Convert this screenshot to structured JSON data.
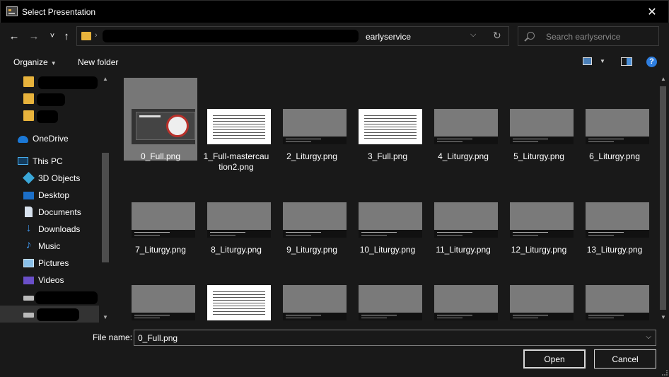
{
  "window": {
    "title": "Select Presentation",
    "close_glyph": "✕"
  },
  "nav": {
    "back_glyph": "←",
    "forward_glyph": "→",
    "recent_glyph": "˅",
    "up_glyph": "↑",
    "address_current": "earlyservice",
    "search_placeholder": "Search earlyservice"
  },
  "toolbar": {
    "organize": "Organize",
    "new_folder": "New folder",
    "help": "?"
  },
  "sidebar": {
    "items": [
      {
        "label": "",
        "icon": "folder-icon"
      },
      {
        "label": "",
        "icon": "folder-icon"
      },
      {
        "label": "",
        "icon": "folder-icon"
      },
      {
        "label": "OneDrive",
        "icon": "onedrive-icon"
      },
      {
        "label": "This PC",
        "icon": "this-pc-icon"
      },
      {
        "label": "3D Objects",
        "icon": "3d-objects-icon"
      },
      {
        "label": "Desktop",
        "icon": "desktop-icon"
      },
      {
        "label": "Documents",
        "icon": "documents-icon"
      },
      {
        "label": "Downloads",
        "icon": "downloads-icon"
      },
      {
        "label": "Music",
        "icon": "music-icon"
      },
      {
        "label": "Pictures",
        "icon": "pictures-icon"
      },
      {
        "label": "Videos",
        "icon": "videos-icon"
      },
      {
        "label": "",
        "icon": "drive-icon"
      },
      {
        "label": "",
        "icon": "drive-icon"
      }
    ]
  },
  "files": [
    {
      "name": "0_Full.png",
      "thumb": "dark",
      "selected": true
    },
    {
      "name": "1_Full-mastercau tion2.png",
      "thumb": "white"
    },
    {
      "name": "2_Liturgy.png",
      "thumb": "gray"
    },
    {
      "name": "3_Full.png",
      "thumb": "white"
    },
    {
      "name": "4_Liturgy.png",
      "thumb": "gray"
    },
    {
      "name": "5_Liturgy.png",
      "thumb": "gray"
    },
    {
      "name": "6_Liturgy.png",
      "thumb": "gray"
    },
    {
      "name": "7_Liturgy.png",
      "thumb": "gray"
    },
    {
      "name": "8_Liturgy.png",
      "thumb": "gray"
    },
    {
      "name": "9_Liturgy.png",
      "thumb": "gray"
    },
    {
      "name": "10_Liturgy.png",
      "thumb": "gray"
    },
    {
      "name": "11_Liturgy.png",
      "thumb": "gray"
    },
    {
      "name": "12_Liturgy.png",
      "thumb": "gray"
    },
    {
      "name": "13_Liturgy.png",
      "thumb": "gray"
    },
    {
      "name": "",
      "thumb": "gray"
    },
    {
      "name": "",
      "thumb": "white"
    },
    {
      "name": "",
      "thumb": "gray"
    },
    {
      "name": "",
      "thumb": "gray"
    },
    {
      "name": "",
      "thumb": "gray"
    },
    {
      "name": "",
      "thumb": "gray"
    },
    {
      "name": "",
      "thumb": "gray"
    }
  ],
  "footer": {
    "file_name_label": "File name:",
    "file_name_value": "0_Full.png",
    "open": "Open",
    "cancel": "Cancel"
  },
  "colors": {
    "background": "#191919",
    "titlebar": "#000000",
    "accent": "#2f7fe0",
    "folder": "#e8b33c"
  }
}
